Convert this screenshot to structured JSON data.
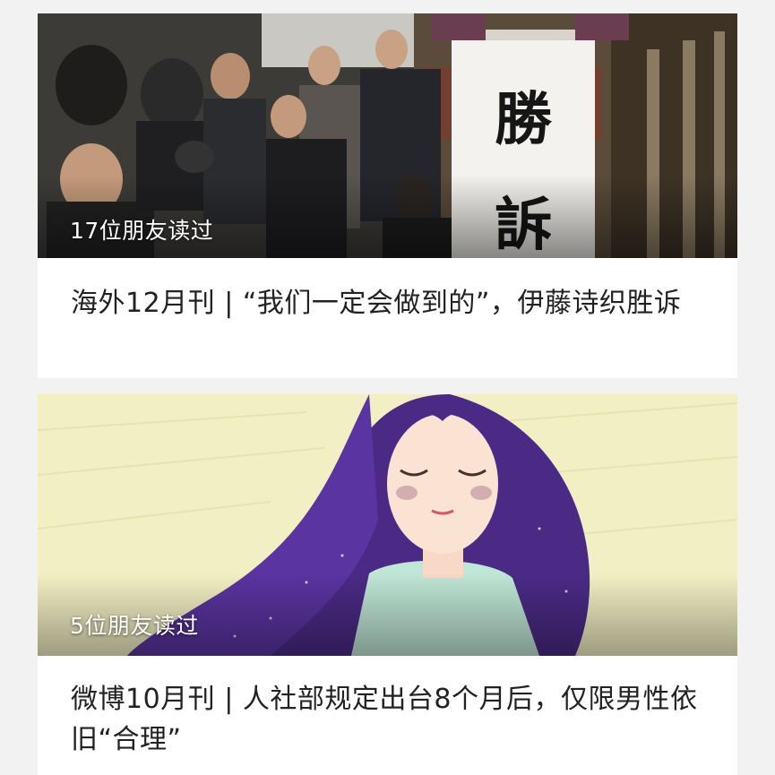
{
  "articles": [
    {
      "readers_text": "17位朋友读过",
      "title": "海外12月刊 | “我们一定会做到的”，伊藤诗织胜诉",
      "banner_text": "勝訴"
    },
    {
      "readers_text": "5位朋友读过",
      "title": "微博10月刊 | 人社部规定出台8个月后，仅限男性依旧“合理”"
    }
  ],
  "colors": {
    "page_bg": "#f2f2f2",
    "card_bg": "#ffffff",
    "title_text": "#222222",
    "overlay_text": "#ffffff",
    "illustration_bg": "#f3efc4",
    "hair": "#4b2a86"
  }
}
